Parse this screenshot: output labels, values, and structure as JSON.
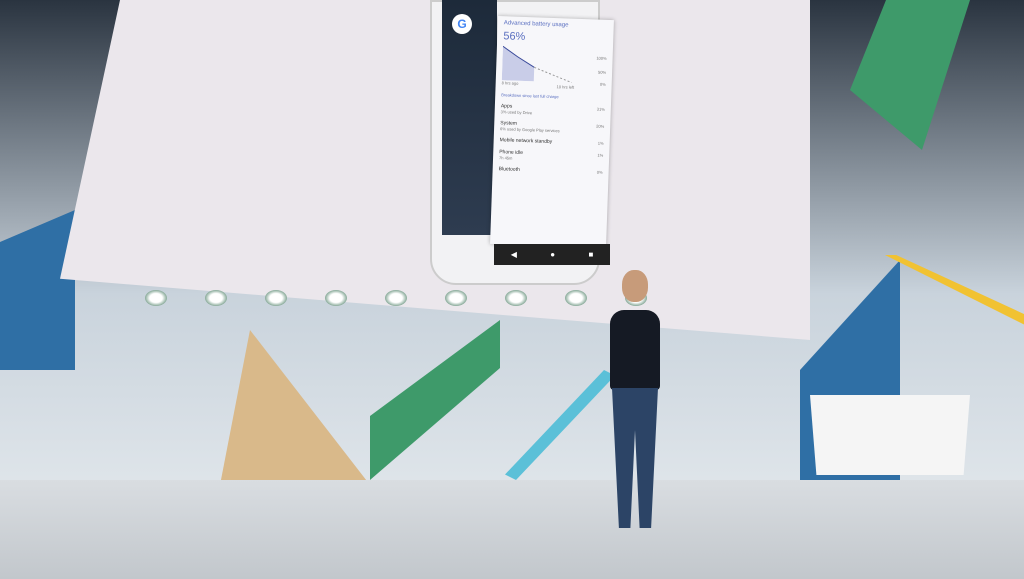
{
  "app_screen": {
    "title": "Advanced battery usage",
    "battery_percent": "56%",
    "chart_labels": {
      "y_top": "100%",
      "y_mid": "50%",
      "y_bottom": "0%",
      "x_left": "8 hrs ago",
      "x_right": "10 hrs left"
    },
    "section_header": "Breakdown since last full charge",
    "items": [
      {
        "name": "Apps",
        "detail": "3% used by Drive",
        "value": "31%"
      },
      {
        "name": "System",
        "detail": "6% used by Google Play services",
        "value": "20%"
      },
      {
        "name": "Mobile network standby",
        "detail": "",
        "value": "1%"
      },
      {
        "name": "Phone idle",
        "detail": "7h 45m",
        "value": "1%"
      },
      {
        "name": "Bluetooth",
        "detail": "",
        "value": "0%"
      }
    ],
    "nav": [
      "◀",
      "●",
      "■"
    ]
  },
  "home_icon": "G",
  "colors": {
    "accent": "#5a6fc0",
    "green": "#3e9a6a",
    "yellow": "#f1c232",
    "blue": "#2f6fa5"
  }
}
